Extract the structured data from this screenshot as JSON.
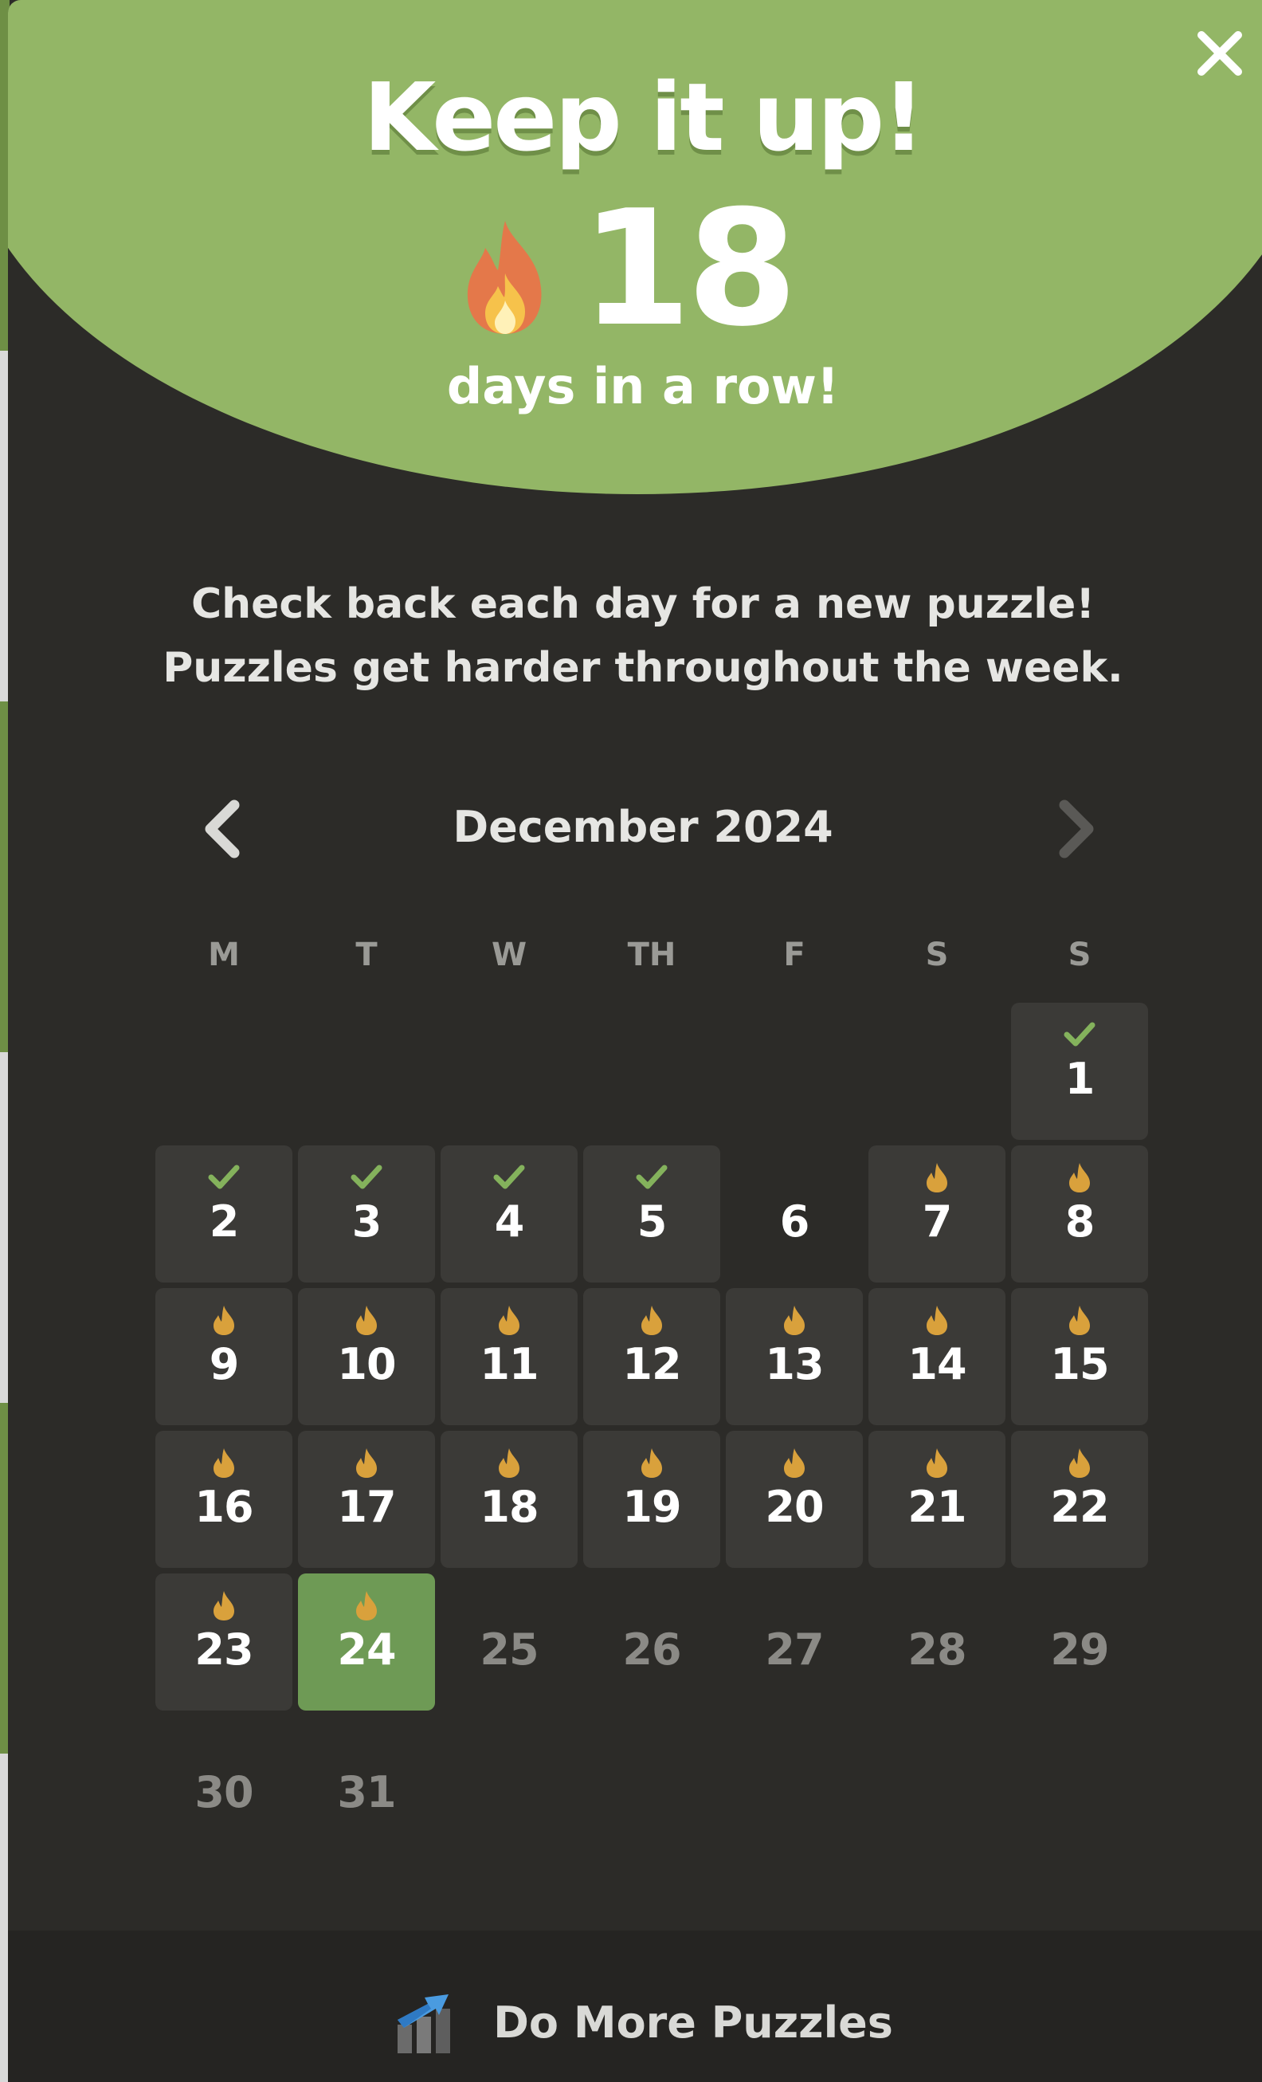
{
  "colors": {
    "hero_green": "#93b666",
    "background": "#2c2b28",
    "tile": "#3b3a37",
    "today_tile": "#6e9a55",
    "check_green": "#84b25c",
    "flame_gold": "#d9a13c",
    "footer": "#252422"
  },
  "header": {
    "title": "Keep it up!",
    "close_icon": "close-icon"
  },
  "streak": {
    "count": "18",
    "label": "days in a row!",
    "icon": "fire-icon"
  },
  "message": {
    "line1": "Check back each day for a new puzzle!",
    "line2": "Puzzles get harder throughout the week."
  },
  "calendar": {
    "month_label": "December 2024",
    "prev_icon": "chevron-left-icon",
    "next_icon": "chevron-right-icon",
    "weekdays": [
      "M",
      "T",
      "W",
      "TH",
      "F",
      "S",
      "S"
    ],
    "days": [
      {
        "day": "1",
        "status": "solved"
      },
      {
        "day": "2",
        "status": "solved"
      },
      {
        "day": "3",
        "status": "solved"
      },
      {
        "day": "4",
        "status": "solved"
      },
      {
        "day": "5",
        "status": "solved"
      },
      {
        "day": "6",
        "status": "missed"
      },
      {
        "day": "7",
        "status": "streak"
      },
      {
        "day": "8",
        "status": "streak"
      },
      {
        "day": "9",
        "status": "streak"
      },
      {
        "day": "10",
        "status": "streak"
      },
      {
        "day": "11",
        "status": "streak"
      },
      {
        "day": "12",
        "status": "streak"
      },
      {
        "day": "13",
        "status": "streak"
      },
      {
        "day": "14",
        "status": "streak"
      },
      {
        "day": "15",
        "status": "streak"
      },
      {
        "day": "16",
        "status": "streak"
      },
      {
        "day": "17",
        "status": "streak"
      },
      {
        "day": "18",
        "status": "streak"
      },
      {
        "day": "19",
        "status": "streak"
      },
      {
        "day": "20",
        "status": "streak"
      },
      {
        "day": "21",
        "status": "streak"
      },
      {
        "day": "22",
        "status": "streak"
      },
      {
        "day": "23",
        "status": "streak"
      },
      {
        "day": "24",
        "status": "today"
      },
      {
        "day": "25",
        "status": "future"
      },
      {
        "day": "26",
        "status": "future"
      },
      {
        "day": "27",
        "status": "future"
      },
      {
        "day": "28",
        "status": "future"
      },
      {
        "day": "29",
        "status": "future"
      },
      {
        "day": "30",
        "status": "future"
      },
      {
        "day": "31",
        "status": "future"
      }
    ]
  },
  "footer": {
    "label": "Do More Puzzles",
    "icon": "chart-arrow-icon"
  }
}
